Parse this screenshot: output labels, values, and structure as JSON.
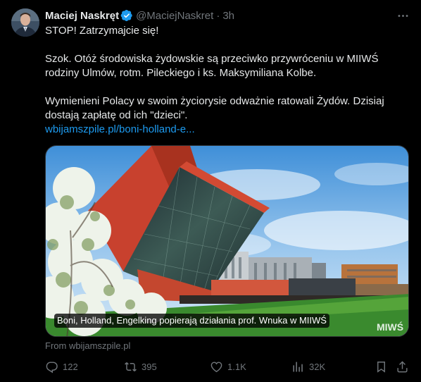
{
  "author": {
    "name": "Maciej Naskręt",
    "handle": "@MaciejNaskret",
    "separator": "·",
    "time": "3h",
    "verified": true
  },
  "tweet": {
    "line1": "STOP! Zatrzymajcie się!",
    "line2": "Szok. Otóż środowiska żydowskie są przeciwko przywróceniu w MIIWŚ rodziny Ulmów, rotm. Pileckiego i ks. Maksymiliana Kolbe.",
    "line3": "Wymienieni Polacy w swoim życiorysie odważnie ratowali Żydów. Dzisiaj dostają zapłatę od ich \"dzieci\".",
    "link_text": "wbijamszpile.pl/boni-holland-e..."
  },
  "card": {
    "caption": "Boni, Holland, Engelking popierają działania prof. Wnuka w MIIWŚ",
    "source": "From wbijamszpile.pl",
    "watermark": "MIWŚ"
  },
  "actions": {
    "replies": "122",
    "reposts": "395",
    "likes": "1.1K",
    "views": "32K"
  },
  "colors": {
    "background": "#000000",
    "text": "#e7e9ea",
    "muted": "#71767b",
    "link": "#1d9bf0",
    "verified": "#1d9bf0"
  }
}
